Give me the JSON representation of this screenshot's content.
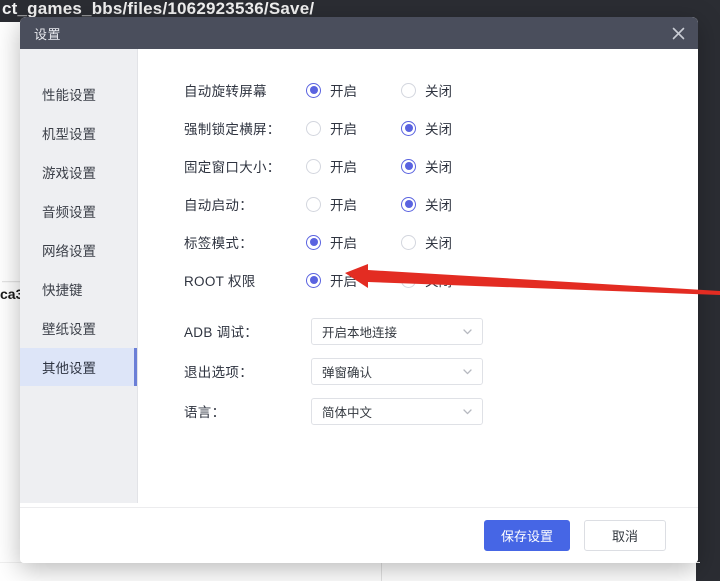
{
  "background": {
    "path_text": "ct_games_bbs/files/1062923536/Save/",
    "side_label": "ca3",
    "side_faint": "——"
  },
  "dialog": {
    "title": "设置",
    "close_icon": "close-icon"
  },
  "sidebar": {
    "items": [
      {
        "label": "性能设置",
        "active": false
      },
      {
        "label": "机型设置",
        "active": false
      },
      {
        "label": "游戏设置",
        "active": false
      },
      {
        "label": "音频设置",
        "active": false
      },
      {
        "label": "网络设置",
        "active": false
      },
      {
        "label": "快捷键",
        "active": false
      },
      {
        "label": "壁纸设置",
        "active": false
      },
      {
        "label": "其他设置",
        "active": true
      }
    ]
  },
  "settings": {
    "radio_rows": [
      {
        "label": "自动旋转屏幕",
        "on_label": "开启",
        "off_label": "关闭",
        "selected": "on"
      },
      {
        "label": "强制锁定横屏：",
        "on_label": "开启",
        "off_label": "关闭",
        "selected": "off"
      },
      {
        "label": "固定窗口大小：",
        "on_label": "开启",
        "off_label": "关闭",
        "selected": "off"
      },
      {
        "label": "自动启动：",
        "on_label": "开启",
        "off_label": "关闭",
        "selected": "off"
      },
      {
        "label": "标签模式：",
        "on_label": "开启",
        "off_label": "关闭",
        "selected": "on"
      },
      {
        "label": "ROOT 权限",
        "on_label": "开启",
        "off_label": "关闭",
        "selected": "on"
      }
    ],
    "select_rows": [
      {
        "label": "ADB 调试：",
        "value": "开启本地连接"
      },
      {
        "label": "退出选项：",
        "value": "弹窗确认"
      },
      {
        "label": "语言：",
        "value": "简体中文"
      }
    ]
  },
  "footer": {
    "save_label": "保存设置",
    "cancel_label": "取消"
  },
  "colors": {
    "titlebar": "#4a4e5c",
    "accent": "#5a63e0",
    "primary_button": "#4666e5",
    "sidebar_active": "#dde5f8",
    "annotation_arrow": "#e32c22"
  }
}
